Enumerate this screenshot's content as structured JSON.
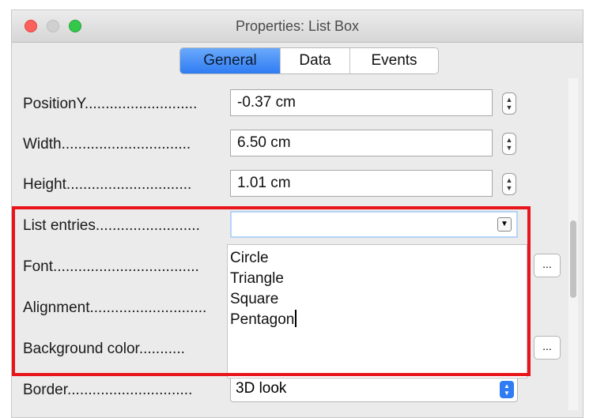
{
  "window": {
    "title": "Properties: List Box"
  },
  "tabs": [
    {
      "label": "General",
      "active": true
    },
    {
      "label": "Data",
      "active": false
    },
    {
      "label": "Events",
      "active": false
    }
  ],
  "fields": {
    "position_y": {
      "label": "PositionY...........................",
      "value": "-0.37 cm"
    },
    "width": {
      "label": "Width...............................",
      "value": "6.50 cm"
    },
    "height": {
      "label": "Height..............................",
      "value": "1.01 cm"
    },
    "list_entries": {
      "label": "List entries.........................",
      "value": ""
    },
    "font": {
      "label": "Font...................................",
      "button": "..."
    },
    "alignment": {
      "label": "Alignment............................"
    },
    "background_color": {
      "label": "Background color...........",
      "button": "..."
    },
    "border": {
      "label": "Border..............................",
      "value": "3D look"
    }
  },
  "list_entries_items": [
    "Circle",
    "Triangle",
    "Square",
    "Pentagon"
  ],
  "colors": {
    "accent": "#2f7cf3",
    "highlight_frame": "#e8151b"
  }
}
